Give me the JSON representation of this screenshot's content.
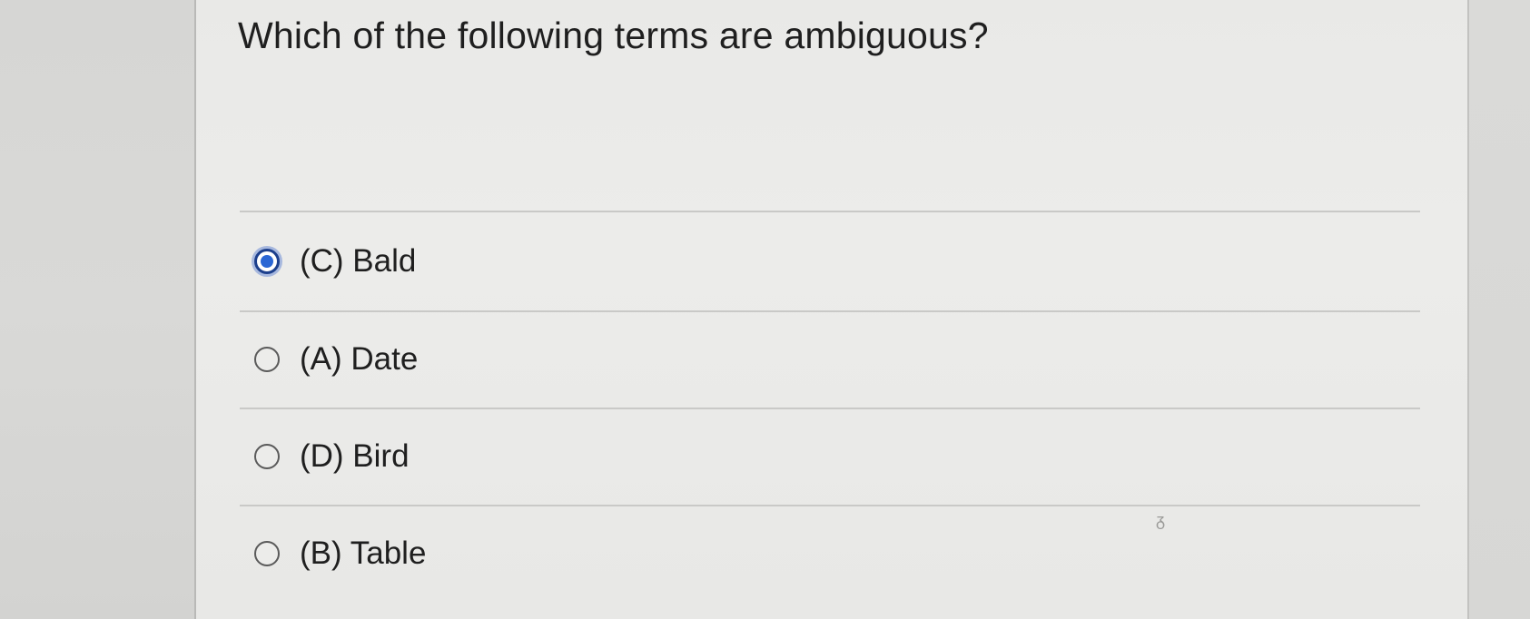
{
  "question": {
    "text": "Which of the following terms are ambiguous?"
  },
  "options": [
    {
      "label": "(C) Bald",
      "selected": true
    },
    {
      "label": "(A) Date",
      "selected": false
    },
    {
      "label": "(D) Bird",
      "selected": false
    },
    {
      "label": "(B) Table",
      "selected": false
    }
  ],
  "colors": {
    "selected_radio": "#2a66d4",
    "text": "#1f1f1f",
    "background": "#e9e9e7"
  }
}
